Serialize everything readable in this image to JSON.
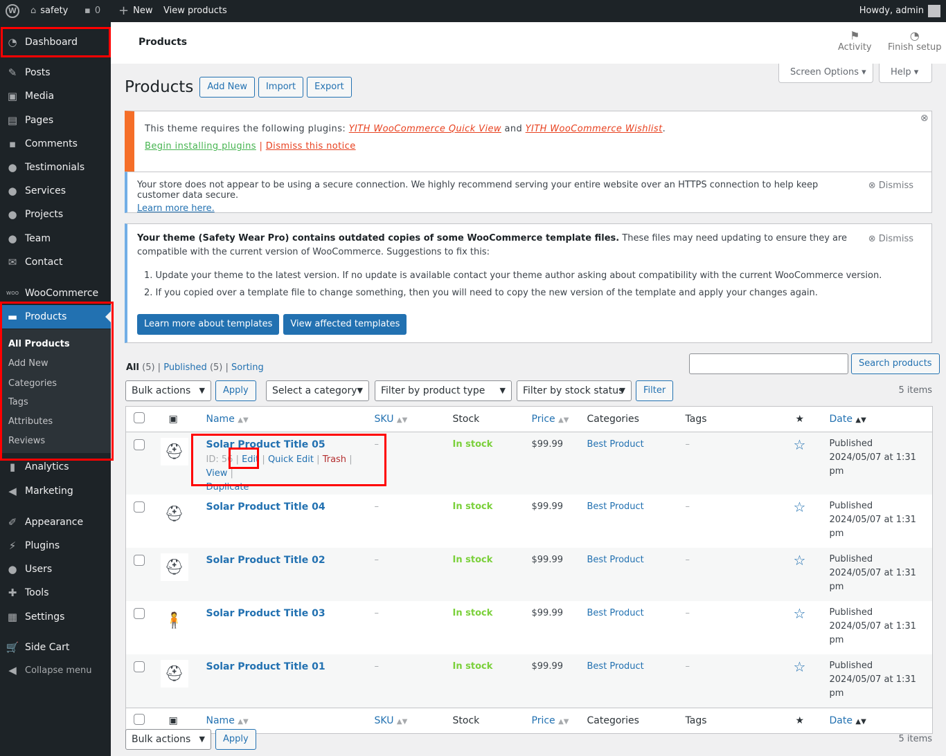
{
  "adminbar": {
    "site": "safety",
    "comments": "0",
    "new": "New",
    "view": "View products",
    "howdy": "Howdy, admin"
  },
  "sidebar": {
    "items": [
      "Dashboard",
      "Posts",
      "Media",
      "Pages",
      "Comments",
      "Testimonials",
      "Services",
      "Projects",
      "Team",
      "Contact",
      "WooCommerce",
      "Products",
      "Analytics",
      "Marketing",
      "Appearance",
      "Plugins",
      "Users",
      "Tools",
      "Settings",
      "Side Cart",
      "Collapse menu"
    ],
    "submenu": [
      "All Products",
      "Add New",
      "Categories",
      "Tags",
      "Attributes",
      "Reviews"
    ]
  },
  "header": {
    "title": "Products",
    "activity": "Activity",
    "finish": "Finish setup"
  },
  "screen_options": "Screen Options",
  "help": "Help",
  "page": {
    "title": "Products",
    "add_new": "Add New",
    "import": "Import",
    "export": "Export"
  },
  "notice1": {
    "text": "This theme requires the following plugins:",
    "p1": "YITH WooCommerce Quick View",
    "and": "and",
    "p2": "YITH WooCommerce Wishlist",
    "dot": ".",
    "begin": "Begin installing plugins",
    "sep": "|",
    "dismiss": "Dismiss this notice"
  },
  "notice2": {
    "text": "Your store does not appear to be using a secure connection. We highly recommend serving your entire website over an HTTPS connection to help keep customer data secure.",
    "link": "Learn more here.",
    "dismiss": "Dismiss"
  },
  "notice3": {
    "bold": "Your theme (Safety Wear Pro) contains outdated copies of some WooCommerce template files.",
    "text": " These files may need updating to ensure they are compatible with the current version of WooCommerce. Suggestions to fix this:",
    "li1": "Update your theme to the latest version. If no update is available contact your theme author asking about compatibility with the current WooCommerce version.",
    "li2": "If you copied over a template file to change something, then you will need to copy the new version of the template and apply your changes again.",
    "btn1": "Learn more about templates",
    "btn2": "View affected templates",
    "dismiss": "Dismiss"
  },
  "views": {
    "all": "All",
    "all_count": "(5)",
    "published": "Published",
    "published_count": "(5)",
    "sorting": "Sorting"
  },
  "search": {
    "value": "",
    "button": "Search products"
  },
  "filters": {
    "bulk": "Bulk actions",
    "apply": "Apply",
    "category": "Select a category",
    "type": "Filter by product type",
    "stock": "Filter by stock status",
    "filter": "Filter",
    "items": "5 items"
  },
  "columns": {
    "name": "Name",
    "sku": "SKU",
    "stock": "Stock",
    "price": "Price",
    "categories": "Categories",
    "tags": "Tags",
    "date": "Date"
  },
  "rows": [
    {
      "name": "Solar Product Title 05",
      "sku": "–",
      "stock": "In stock",
      "price": "$99.99",
      "category": "Best Product",
      "tags": "–",
      "status": "Published",
      "date": "2024/05/07 at 1:31 pm",
      "thumb": "hard-hat"
    },
    {
      "name": "Solar Product Title 04",
      "sku": "–",
      "stock": "In stock",
      "price": "$99.99",
      "category": "Best Product",
      "tags": "–",
      "status": "Published",
      "date": "2024/05/07 at 1:31 pm",
      "thumb": "hard-hat-earmuffs"
    },
    {
      "name": "Solar Product Title 02",
      "sku": "–",
      "stock": "In stock",
      "price": "$99.99",
      "category": "Best Product",
      "tags": "–",
      "status": "Published",
      "date": "2024/05/07 at 1:31 pm",
      "thumb": "hard-hat"
    },
    {
      "name": "Solar Product Title 03",
      "sku": "–",
      "stock": "In stock",
      "price": "$99.99",
      "category": "Best Product",
      "tags": "–",
      "status": "Published",
      "date": "2024/05/07 at 1:31 pm",
      "thumb": "worker"
    },
    {
      "name": "Solar Product Title 01",
      "sku": "–",
      "stock": "In stock",
      "price": "$99.99",
      "category": "Best Product",
      "tags": "–",
      "status": "Published",
      "date": "2024/05/07 at 1:31 pm",
      "thumb": "helmets"
    }
  ],
  "row_actions": {
    "id": "ID: 56",
    "edit": "Edit",
    "quick_edit": "Quick Edit",
    "trash": "Trash",
    "view": "View",
    "duplicate": "Duplicate",
    "sep": "|"
  },
  "colors": {
    "accent": "#2271b1",
    "highlight": "#ff0000",
    "instock": "#7ad03a",
    "trash": "#b32d2e"
  }
}
